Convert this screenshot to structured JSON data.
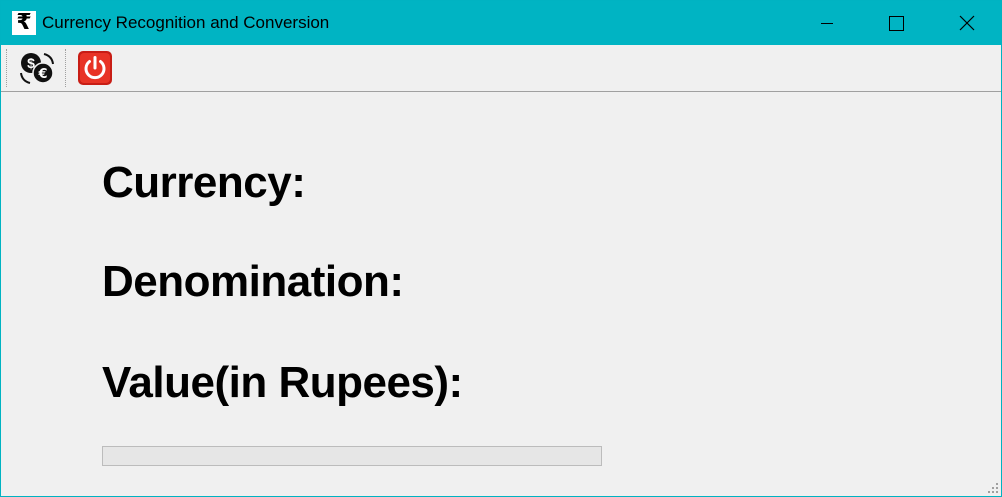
{
  "window": {
    "title": "Currency Recognition and Conversion",
    "app_icon_glyph": "₹",
    "icon": "rupee-icon"
  },
  "window_controls": {
    "minimize": "minimize-icon",
    "maximize": "maximize-icon",
    "close": "close-icon"
  },
  "toolbar": {
    "buttons": [
      {
        "name": "currency-exchange-button",
        "icon": "currency-exchange-icon"
      },
      {
        "name": "power-button",
        "icon": "power-icon"
      }
    ]
  },
  "labels": {
    "currency": "Currency:",
    "denomination": "Denomination:",
    "value": "Value(in Rupees):"
  },
  "progress": {
    "value": 0
  },
  "colors": {
    "titlebar": "#00b4c3",
    "background": "#f0f0f0",
    "power_button": "#e02a1f"
  }
}
